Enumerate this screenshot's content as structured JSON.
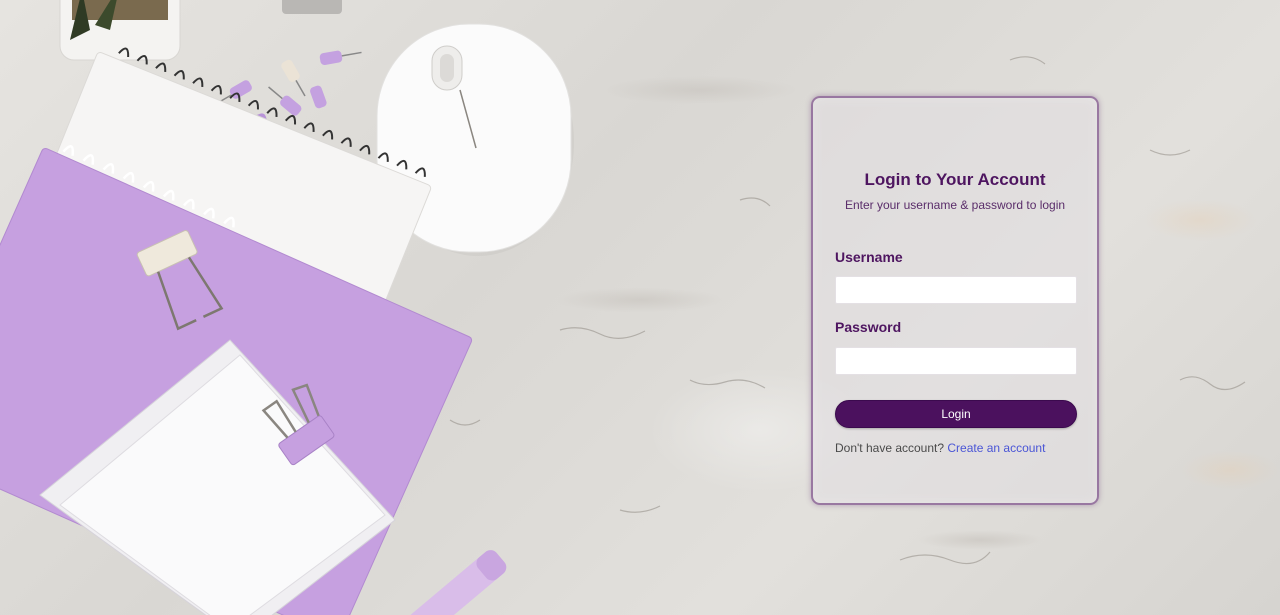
{
  "login": {
    "title": "Login to Your Account",
    "subtitle": "Enter your username & password to login",
    "username_label": "Username",
    "username_value": "",
    "password_label": "Password",
    "password_value": "",
    "button_label": "Login",
    "signup_prompt": "Don't have account? ",
    "signup_link": "Create an account"
  },
  "colors": {
    "brand_purple": "#4b115e",
    "heading": "#4e1560",
    "link": "#4a55d6",
    "notebook_purple": "#c6a0e0"
  },
  "scene": {
    "objects": [
      "potted-plant",
      "push-pins",
      "computer-mouse",
      "spiral-notebooks",
      "binder-clips",
      "sticky-notes",
      "highlighter-pen"
    ]
  }
}
